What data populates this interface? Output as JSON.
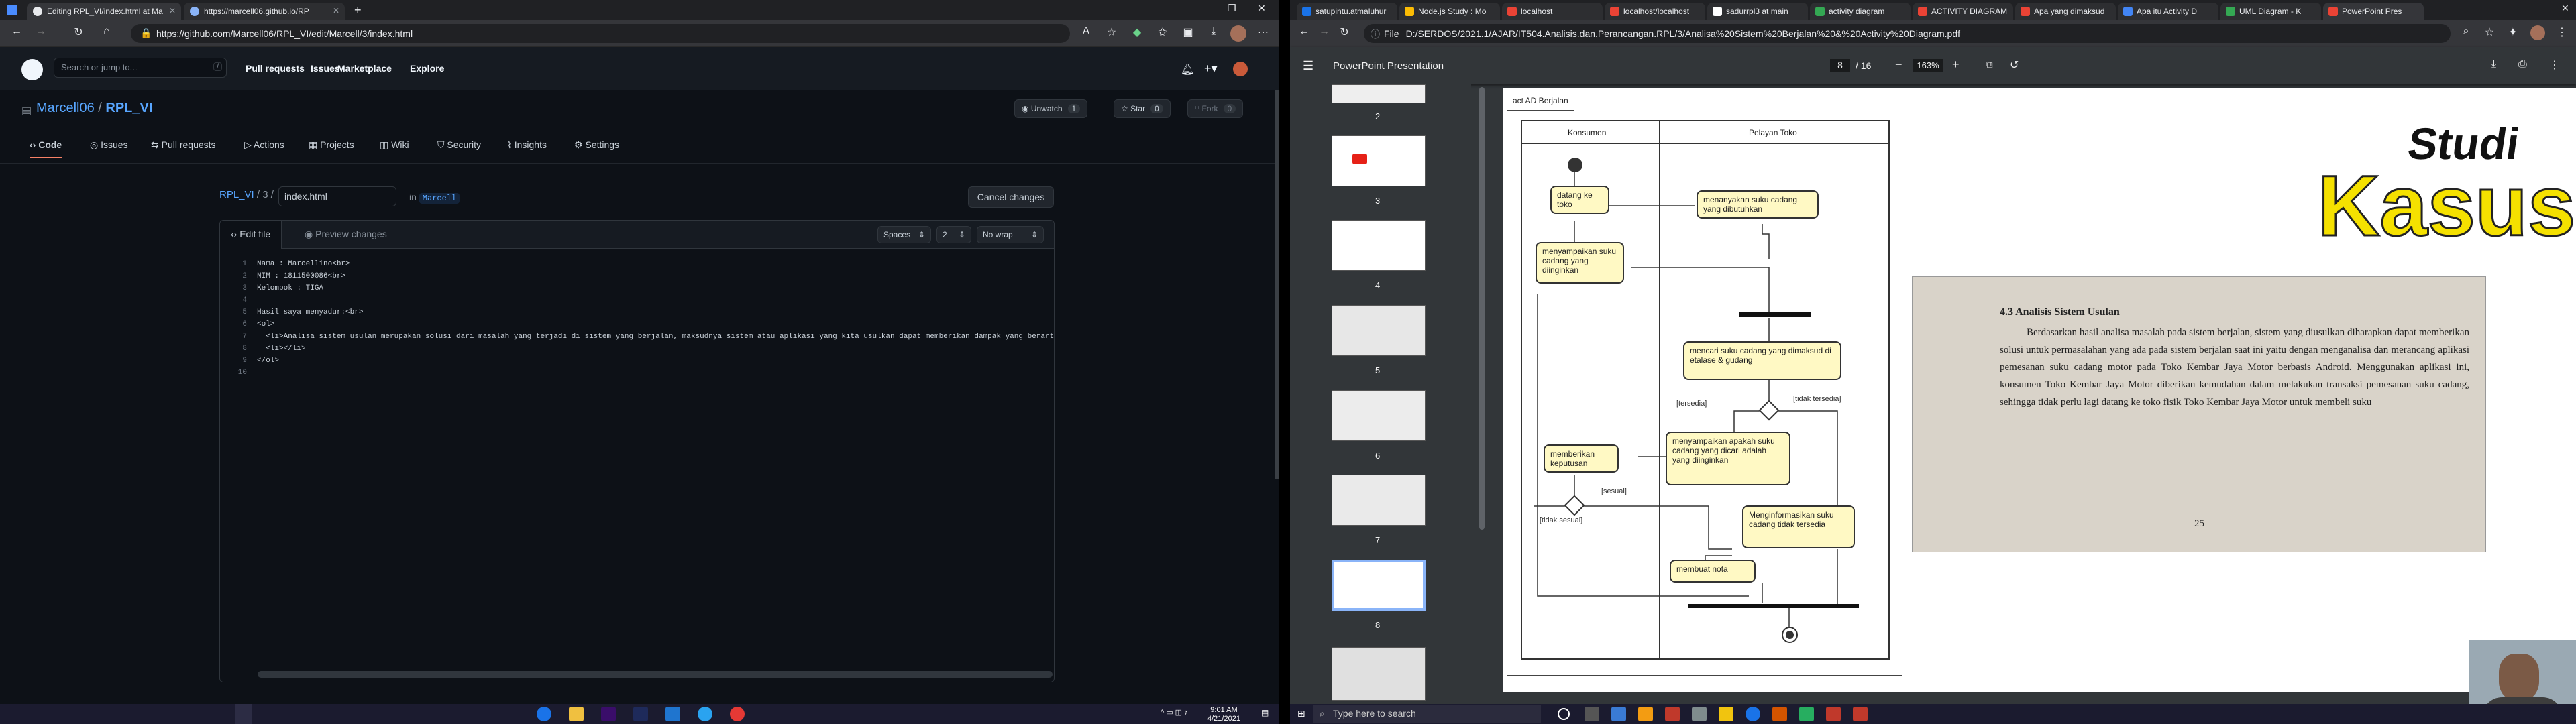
{
  "left_browser": {
    "tabs": [
      {
        "title": "Editing RPL_VI/index.html at Ma",
        "active": true
      },
      {
        "title": "https://marcell06.github.io/RP",
        "active": false
      }
    ],
    "url": "https://github.com/Marcell06/RPL_VI/edit/Marcell/3/index.html",
    "github": {
      "search_placeholder": "Search or jump to...",
      "search_key": "/",
      "nav": [
        "Pull requests",
        "Issues",
        "Marketplace",
        "Explore"
      ],
      "repo_owner": "Marcell06",
      "repo_sep": " / ",
      "repo_name": "RPL_VI",
      "watch": {
        "label": "Unwatch",
        "count": "1"
      },
      "star": {
        "label": "Star",
        "count": "0"
      },
      "fork": {
        "label": "Fork",
        "count": "0"
      },
      "repo_tabs": [
        "Code",
        "Issues",
        "Pull requests",
        "Actions",
        "Projects",
        "Wiki",
        "Security",
        "Insights",
        "Settings"
      ],
      "breadcrumb_repo": "RPL_VI",
      "breadcrumb_path": " / 3 / ",
      "filename": "index.html",
      "branch_prefix": "in",
      "branch": "Marcell",
      "cancel_label": "Cancel changes",
      "edit_tab": "Edit file",
      "preview_tab": "Preview changes",
      "indent_mode": "Spaces",
      "indent_size": "2",
      "wrap_mode": "No wrap",
      "code_lines": [
        {
          "n": "1",
          "text": "Nama : Marcellino<br>"
        },
        {
          "n": "2",
          "text": "NIM : 1811500086<br>"
        },
        {
          "n": "3",
          "text": "Kelompok : TIGA"
        },
        {
          "n": "4",
          "text": ""
        },
        {
          "n": "5",
          "text": "Hasil saya menyadur:<br>"
        },
        {
          "n": "6",
          "text": "<ol>"
        },
        {
          "n": "7",
          "text": "  <li>Analisa sistem usulan merupakan solusi dari masalah yang terjadi di sistem yang berjalan, maksudnya sistem atau aplikasi yang kita usulkan dapat memberikan dampak yang berarti"
        },
        {
          "n": "8",
          "text": "  <li></li>"
        },
        {
          "n": "9",
          "text": "</ol>"
        },
        {
          "n": "10",
          "text": ""
        }
      ]
    }
  },
  "right_browser": {
    "tabs": [
      {
        "title": "satupintu.atmaluhur",
        "color": "#1a73e8"
      },
      {
        "title": "Node.js Study : Mo",
        "color": "#fbbc04"
      },
      {
        "title": "localhost",
        "color": "#ea4335"
      },
      {
        "title": "localhost/localhost",
        "color": "#ea4335"
      },
      {
        "title": "sadurrpl3 at main",
        "color": "#ffffff"
      },
      {
        "title": "activity diagram",
        "color": "#34a853"
      },
      {
        "title": "ACTIVITY DIAGRAM",
        "color": "#ea4335"
      },
      {
        "title": "Apa yang dimaksud",
        "color": "#ea4335"
      },
      {
        "title": "Apa itu Activity D",
        "color": "#4285f4"
      },
      {
        "title": "UML Diagram - K",
        "color": "#34a853"
      },
      {
        "title": "PowerPoint Pres",
        "color": "#ea4335",
        "active": true
      }
    ],
    "url_prefix": "File",
    "url": "D:/SERDOS/2021.1/AJAR/IT504.Analisis.dan.Perancangan.RPL/3/Analisa%20Sistem%20Berjalan%20&%20Activity%20Diagram.pdf",
    "pdf": {
      "title": "PowerPoint Presentation",
      "page": "8",
      "total": "/ 16",
      "zoom": "163%",
      "thumbnail_numbers": [
        "2",
        "3",
        "4",
        "5",
        "6",
        "7",
        "8"
      ],
      "selected_page": "8"
    },
    "slide": {
      "diagram_title": "act AD Berjalan",
      "lane1": "Konsumen",
      "lane2": "Pelayan Toko",
      "actions": {
        "a1": "datang ke toko",
        "a2": "menanyakan suku cadang yang dibutuhkan",
        "a3": "menyampaikan suku cadang yang diinginkan",
        "a4": "mencari suku cadang yang dimaksud di etalase & gudang",
        "a5": "menyampaikan apakah suku cadang yang dicari adalah yang diinginkan",
        "a6": "memberikan keputusan",
        "a7": "Menginformasikan suku cadang tidak tersedia",
        "a8": "membuat nota"
      },
      "guards": {
        "tersedia": "[tersedia]",
        "tidak_tersedia": "[tidak tersedia]",
        "sesuai": "[sesuai]",
        "tidak_sesuai": "[tidak sesuai]"
      },
      "studi": "Studi",
      "kasus": "Kasus",
      "photo_heading": "4.3   Analisis Sistem Usulan",
      "photo_text": "Berdasarkan hasil analisa masalah pada sistem berjalan, sistem yang diusulkan diharapkan dapat memberikan solusi untuk permasalahan yang ada pada sistem berjalan saat ini yaitu dengan menganalisa dan merancang aplikasi pemesanan suku cadang motor pada Toko Kembar Jaya Motor berbasis Android. Menggunakan aplikasi ini, konsumen Toko Kembar Jaya Motor diberikan kemudahan dalam melakukan transaksi pemesanan suku cadang, sehingga tidak perlu lagi datang ke toko fisik Toko Kembar Jaya Motor untuk membeli suku",
      "photo_page": "25"
    }
  },
  "taskbar": {
    "left_time": "9:01 AM",
    "left_date": "4/21/2021",
    "search_placeholder": "Type here to search"
  }
}
